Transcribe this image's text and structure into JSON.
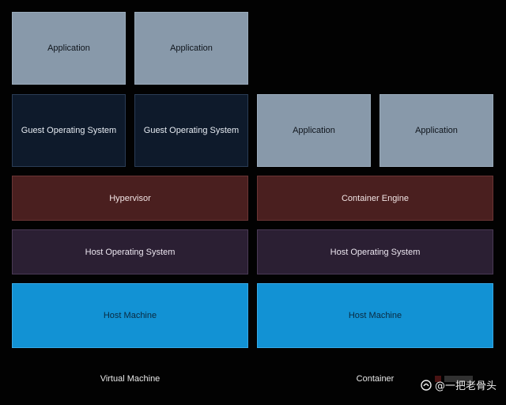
{
  "vm": {
    "row1": [
      "Application",
      "Application"
    ],
    "row2": [
      "Guest Operating System",
      "Guest Operating System"
    ],
    "hypervisor": "Hypervisor",
    "host_os": "Host Operating System",
    "host_machine": "Host Machine",
    "caption": "Virtual Machine"
  },
  "container": {
    "row2": [
      "Application",
      "Application"
    ],
    "engine": "Container Engine",
    "host_os": "Host Operating System",
    "host_machine": "Host Machine",
    "caption": "Container"
  },
  "watermark": {
    "text": "@一把老骨头"
  },
  "colors": {
    "application": "#8899aa",
    "guest_os": "#0e1a2b",
    "hypervisor": "#4a1f1f",
    "host_os": "#2b1f33",
    "host_machine": "#1292d4"
  }
}
